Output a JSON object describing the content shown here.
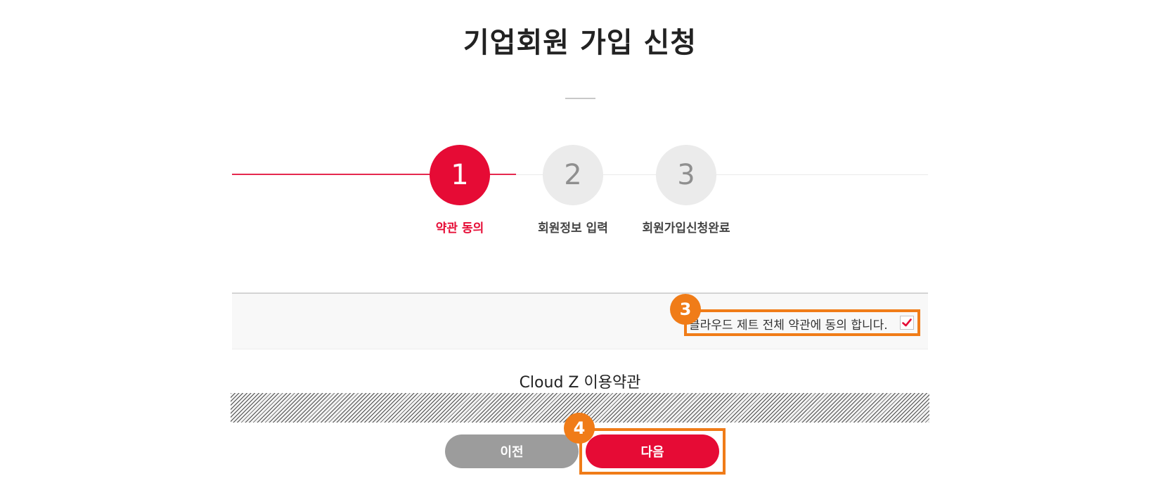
{
  "page": {
    "title": "기업회원 가입 신청"
  },
  "steps": [
    {
      "number": "1",
      "label": "약관 동의",
      "state": "active"
    },
    {
      "number": "2",
      "label": "회원정보 입력",
      "state": "inactive"
    },
    {
      "number": "3",
      "label": "회원가입신청완료",
      "state": "inactive"
    }
  ],
  "agreement": {
    "label": "클라우드 제트 전체 약관에 동의 합니다.",
    "checked": true,
    "check_color": "#e60b35"
  },
  "terms": {
    "title": "Cloud Z 이용약관"
  },
  "buttons": {
    "prev_label": "이전",
    "next_label": "다음"
  },
  "annotations": {
    "badge_agree": "3",
    "badge_next": "4",
    "highlight_color": "#f07c18"
  },
  "colors": {
    "accent": "#e60b35",
    "inactive_step": "#ebebeb",
    "prev_button": "#9c9c9c"
  }
}
